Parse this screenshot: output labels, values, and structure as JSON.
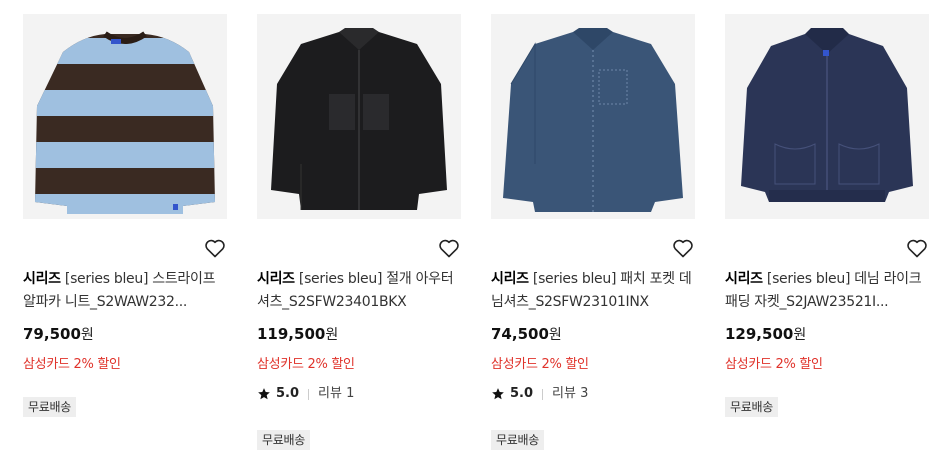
{
  "products": [
    {
      "brand": "시리즈",
      "name": "[series bleu] 스트라이프 알파카 니트_S2WAW232...",
      "price": "79,500",
      "currency": "원",
      "discount": "삼성카드 2% 할인",
      "rating": null,
      "reviews": null,
      "shipping": "무료배송"
    },
    {
      "brand": "시리즈",
      "name": "[series bleu] 절개 아우터 셔츠_S2SFW23401BKX",
      "price": "119,500",
      "currency": "원",
      "discount": "삼성카드 2% 할인",
      "rating": "5.0",
      "reviews": "리뷰 1",
      "shipping": "무료배송"
    },
    {
      "brand": "시리즈",
      "name": "[series bleu] 패치 포켓 데님셔츠_S2SFW23101INX",
      "price": "74,500",
      "currency": "원",
      "discount": "삼성카드 2% 할인",
      "rating": "5.0",
      "reviews": "리뷰 3",
      "shipping": "무료배송"
    },
    {
      "brand": "시리즈",
      "name": "[series bleu] 데님 라이크 패딩 자켓_S2JAW23521I...",
      "price": "129,500",
      "currency": "원",
      "discount": "삼성카드 2% 할인",
      "rating": null,
      "reviews": null,
      "shipping": "무료배송"
    }
  ],
  "colors": {
    "discount": "#e0332b",
    "badge_bg": "#eeeeee",
    "thumb_bg": "#f3f3f3"
  },
  "icons": {
    "wishlist": "heart-outline-icon",
    "rating": "star-icon"
  }
}
